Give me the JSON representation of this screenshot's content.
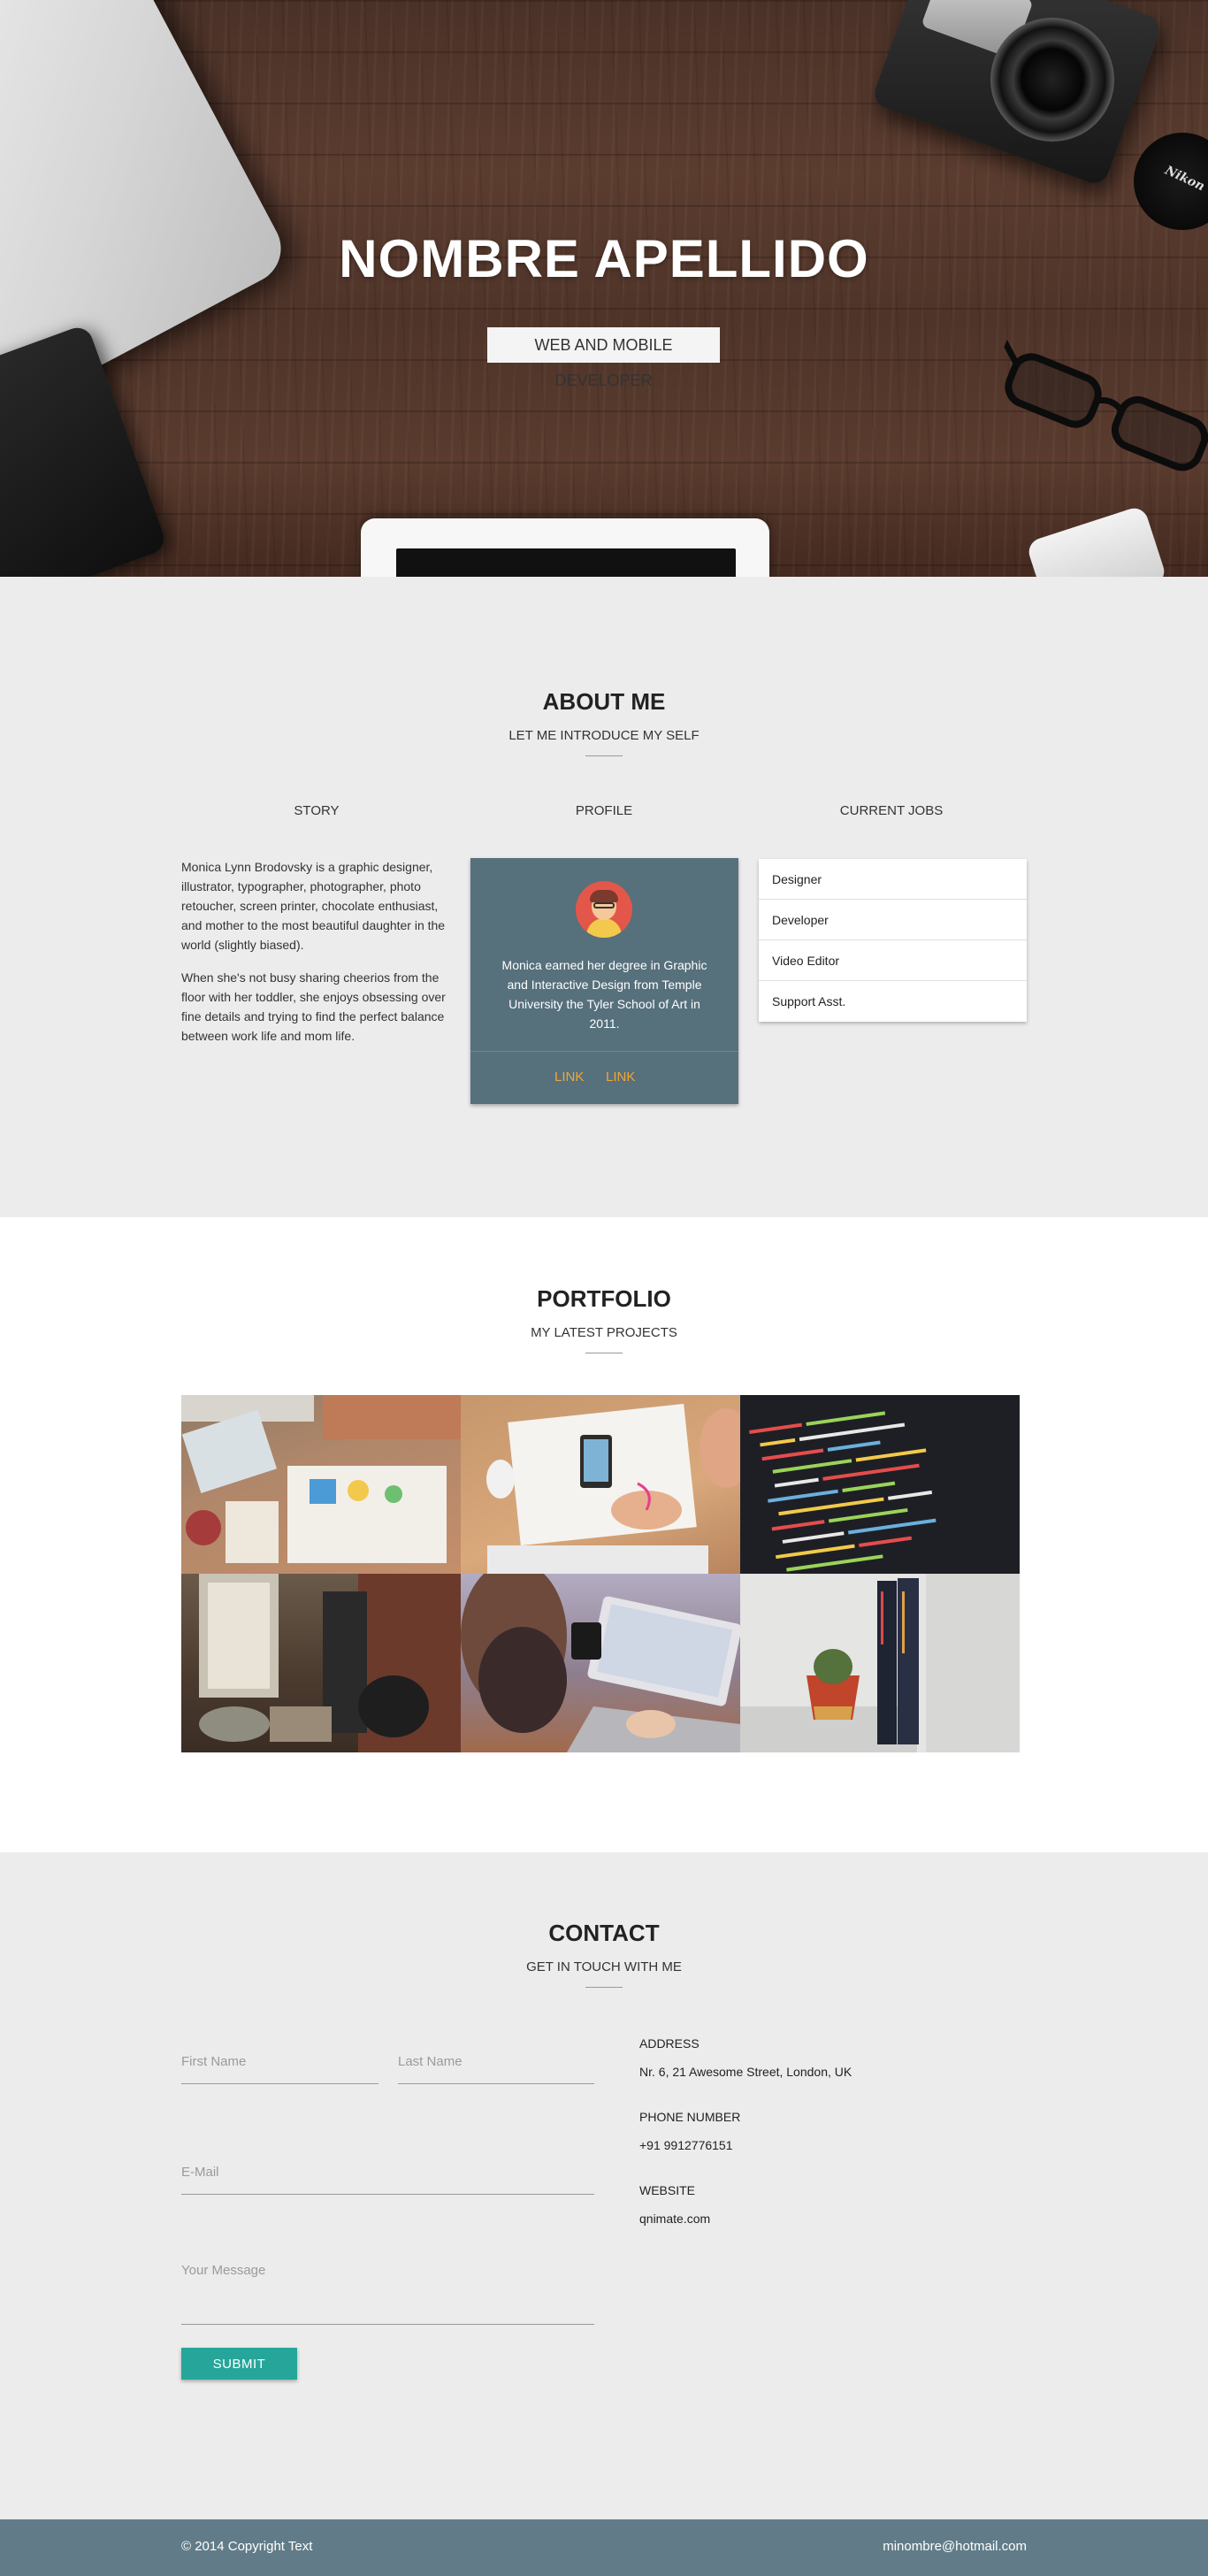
{
  "hero": {
    "title": "NOMBRE APELLIDO",
    "subtitle": "WEB AND MOBILE DEVELOPER",
    "lens_brand": "Nikon"
  },
  "about": {
    "title": "ABOUT ME",
    "subtitle": "LET ME INTRODUCE MY SELF",
    "columns": [
      "STORY",
      "PROFILE",
      "CURRENT JOBS"
    ],
    "story": [
      "Monica Lynn Brodovsky is a graphic designer, illustrator, typographer, photographer, photo retoucher, screen printer, chocolate enthusiast, and mother to the most beautiful daughter in the world (slightly biased).",
      "When she's not busy sharing cheerios from the floor with her toddler, she enjoys obsessing over fine details and trying to find the perfect balance between work life and mom life."
    ],
    "profile": {
      "text": "Monica earned her degree in Graphic and Interactive Design from Temple University the Tyler School of Art in 2011.",
      "links": [
        "LINK",
        "LINK"
      ]
    },
    "jobs": [
      "Designer",
      "Developer",
      "Video Editor",
      "Support Asst."
    ]
  },
  "portfolio": {
    "title": "PORTFOLIO",
    "subtitle": "MY LATEST PROJECTS"
  },
  "contact": {
    "title": "CONTACT",
    "subtitle": "GET IN TOUCH WITH ME",
    "form": {
      "first_name_placeholder": "First Name",
      "last_name_placeholder": "Last Name",
      "email_placeholder": "E-Mail",
      "message_placeholder": "Your Message",
      "submit_label": "SUBMIT"
    },
    "info": {
      "address_label": "ADDRESS",
      "address_value": "Nr. 6, 21 Awesome Street, London, UK",
      "phone_label": "PHONE NUMBER",
      "phone_value": "+91 9912776151",
      "website_label": "WEBSITE",
      "website_value": "qnimate.com"
    }
  },
  "footer": {
    "copyright": "© 2014 Copyright Text",
    "email": "minombre@hotmail.com"
  },
  "colors": {
    "profile_card": "#56707c",
    "link_accent": "#f0a73a",
    "submit_button": "#26a69a",
    "footer": "#617c88"
  }
}
